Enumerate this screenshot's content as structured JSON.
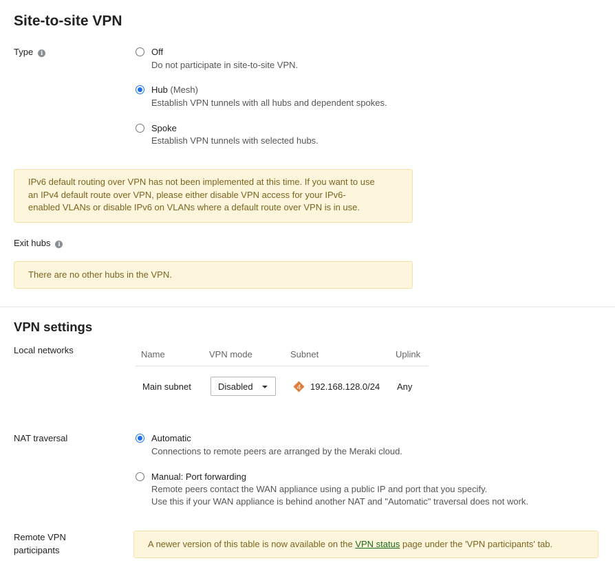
{
  "site_to_site": {
    "title": "Site-to-site VPN",
    "type_label": "Type",
    "options": [
      {
        "title": "Off",
        "suffix": "",
        "desc": "Do not participate in site-to-site VPN.",
        "checked": false
      },
      {
        "title": "Hub",
        "suffix": "(Mesh)",
        "desc": "Establish VPN tunnels with all hubs and dependent spokes.",
        "checked": true
      },
      {
        "title": "Spoke",
        "suffix": "",
        "desc": "Establish VPN tunnels with selected hubs.",
        "checked": false
      }
    ],
    "ipv6_notice": {
      "line1": "IPv6 default routing over VPN has not been implemented at this time. If you want to use",
      "line2": "an IPv4 default route over VPN, please either disable VPN access for your IPv6-",
      "line3": "enabled VLANs or disable IPv6 on VLANs where a default route over VPN is in use."
    },
    "exit_hubs_label": "Exit hubs",
    "no_hubs_notice": "There are no other hubs in the VPN."
  },
  "vpn_settings": {
    "title": "VPN settings",
    "local_networks_label": "Local networks",
    "table": {
      "headers": [
        "Name",
        "VPN mode",
        "Subnet",
        "Uplink"
      ],
      "rows": [
        {
          "name": "Main subnet",
          "vpn_mode": "Disabled",
          "vlan_badge": "4",
          "subnet": "192.168.128.0/24",
          "uplink": "Any"
        }
      ]
    },
    "nat_label": "NAT traversal",
    "nat_options": [
      {
        "title": "Automatic",
        "desc1": "Connections to remote peers are arranged by the Meraki cloud.",
        "desc2": "",
        "checked": true
      },
      {
        "title": "Manual: Port forwarding",
        "desc1": "Remote peers contact the WAN appliance using a public IP and port that you specify.",
        "desc2": "Use this if your WAN appliance is behind another NAT and \"Automatic\" traversal does not work.",
        "checked": false
      }
    ],
    "remote_label_line1": "Remote VPN",
    "remote_label_line2": "participants",
    "remote_notice": {
      "before": "A newer version of this table is now available on the ",
      "link": "VPN status",
      "after": " page under the 'VPN participants' tab."
    }
  },
  "colors": {
    "accent": "#1a73e8",
    "notice_bg": "#fdf6dd",
    "notice_text": "#7a6420",
    "vlan_badge": "#e07b39",
    "link": "#1a6a17"
  },
  "icons": [
    "info-icon",
    "vlan-badge-icon",
    "caret-down-icon"
  ]
}
